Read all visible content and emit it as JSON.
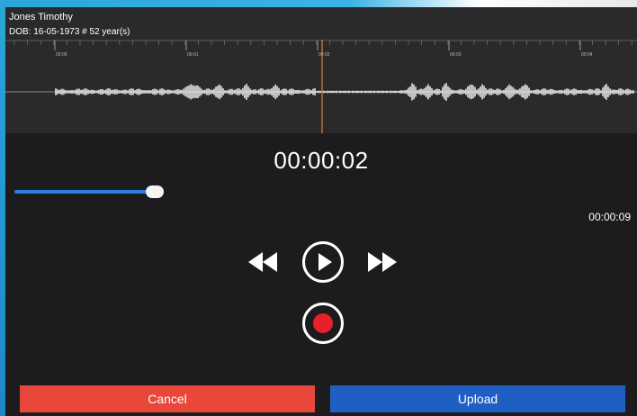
{
  "patient": {
    "name": "Jones Timothy",
    "dob_line": "DOB: 16-05-1973 # 52 year(s)"
  },
  "timeline": {
    "tick_labels": [
      "00:00",
      "00:01",
      "00:02",
      "00:03",
      "00:04"
    ]
  },
  "player": {
    "current_time": "00:00:02",
    "duration": "00:00:09",
    "progress": 0.22
  },
  "icons": {
    "rewind": "rewind-icon",
    "play": "play-icon",
    "fast_forward": "fast-forward-icon",
    "record": "record-icon"
  },
  "colors": {
    "accent": "#2a7fe0",
    "record": "#e8202a",
    "cancel": "#e8473a",
    "upload": "#1f5fc4",
    "playhead": "#d9822b"
  },
  "actions": {
    "cancel_label": "Cancel",
    "upload_label": "Upload"
  }
}
